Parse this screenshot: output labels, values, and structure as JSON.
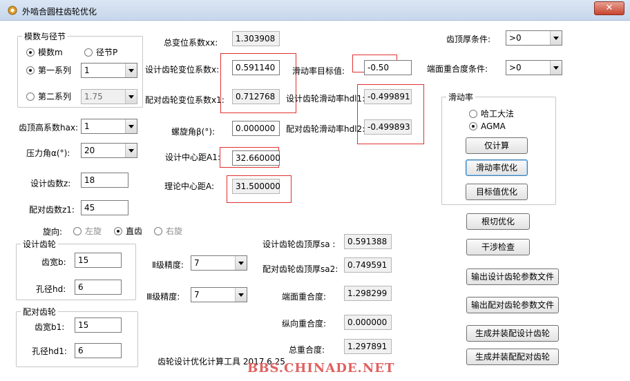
{
  "window": {
    "title": "外啮合圆柱齿轮优化",
    "close_glyph": "✕"
  },
  "module_group": {
    "title": "模数与径节",
    "radio_module": "模数m",
    "radio_pitch": "径节P",
    "radio_series1": "第一系列",
    "series1_value": "1",
    "radio_series2": "第二系列",
    "series2_value": "1.75"
  },
  "hax": {
    "label": "齿顶高系数hax:",
    "value": "1"
  },
  "pressure_angle": {
    "label": "压力角α(°):",
    "value": "20"
  },
  "teeth_z": {
    "label": "设计齿数z:",
    "value": "18"
  },
  "teeth_z1": {
    "label": "配对齿数z1:",
    "value": "45"
  },
  "rotation": {
    "label": "旋向:",
    "left": "左旋",
    "straight": "直齿",
    "right": "右旋"
  },
  "design_gear": {
    "title": "设计齿轮",
    "width_label": "齿宽b:",
    "width_value": "15",
    "bore_label": "孔径hd:",
    "bore_value": "6"
  },
  "mate_gear": {
    "title": "配对齿轮",
    "width_label": "齿宽b1:",
    "width_value": "15",
    "bore_label": "孔径hd1:",
    "bore_value": "6"
  },
  "total_shift": {
    "label": "总变位系数xx:",
    "value": "1.303908"
  },
  "design_shift": {
    "label": "设计齿轮变位系数x:",
    "value": "0.591140"
  },
  "mate_shift": {
    "label": "配对齿轮变位系数x1:",
    "value": "0.712768"
  },
  "helix": {
    "label": "螺旋角β(°):",
    "value": "0.000000"
  },
  "design_center": {
    "label": "设计中心距A1:",
    "value": "32.660000"
  },
  "theory_center": {
    "label": "理论中心距A:",
    "value": "31.500000"
  },
  "slip_target": {
    "label": "滑动率目标值:",
    "value": "-0.50"
  },
  "design_slip": {
    "label": "设计齿轮滑动率hdl1:",
    "value": "-0.499891"
  },
  "mate_slip": {
    "label": "配对齿轮滑动率hdl2:",
    "value": "-0.499893"
  },
  "tip_thickness_cond": {
    "label": "齿顶厚条件:",
    "value": ">0"
  },
  "overlap_cond": {
    "label": "端面重合度条件:",
    "value": ">0"
  },
  "slip_group": {
    "title": "滑动率",
    "radio_hagong": "哈工大法",
    "radio_agma": "AGMA",
    "btn_calc": "仅计算",
    "btn_slip_opt": "滑动率优化",
    "btn_target_opt": "目标值优化"
  },
  "buttons": {
    "root_cut": "根切优化",
    "interference": "干涉检查",
    "export_design": "输出设计齿轮参数文件",
    "export_mate": "输出配对齿轮参数文件",
    "gen_design": "生成并装配设计齿轮",
    "gen_mate": "生成并装配配对齿轮"
  },
  "grade2": {
    "label": "Ⅱ级精度:",
    "value": "7"
  },
  "grade3": {
    "label": "Ⅲ级精度:",
    "value": "7"
  },
  "sa": {
    "label": "设计齿轮齿顶厚sa :",
    "value": "0.591388"
  },
  "sa2": {
    "label": "配对齿轮齿顶厚sa2:",
    "value": "0.749591"
  },
  "end_overlap": {
    "label": "端面重合度:",
    "value": "1.298299"
  },
  "axial_overlap": {
    "label": "纵向重合度:",
    "value": "0.000000"
  },
  "total_overlap": {
    "label": "总重合度:",
    "value": "1.297891"
  },
  "footer": {
    "tool": "齿轮设计优化计算工具 2017.6.25",
    "watermark": "BBS.CHINADE.NET"
  },
  "colors": {
    "highlight_box": "#e03030",
    "titlebar": "#c7d7ec"
  }
}
